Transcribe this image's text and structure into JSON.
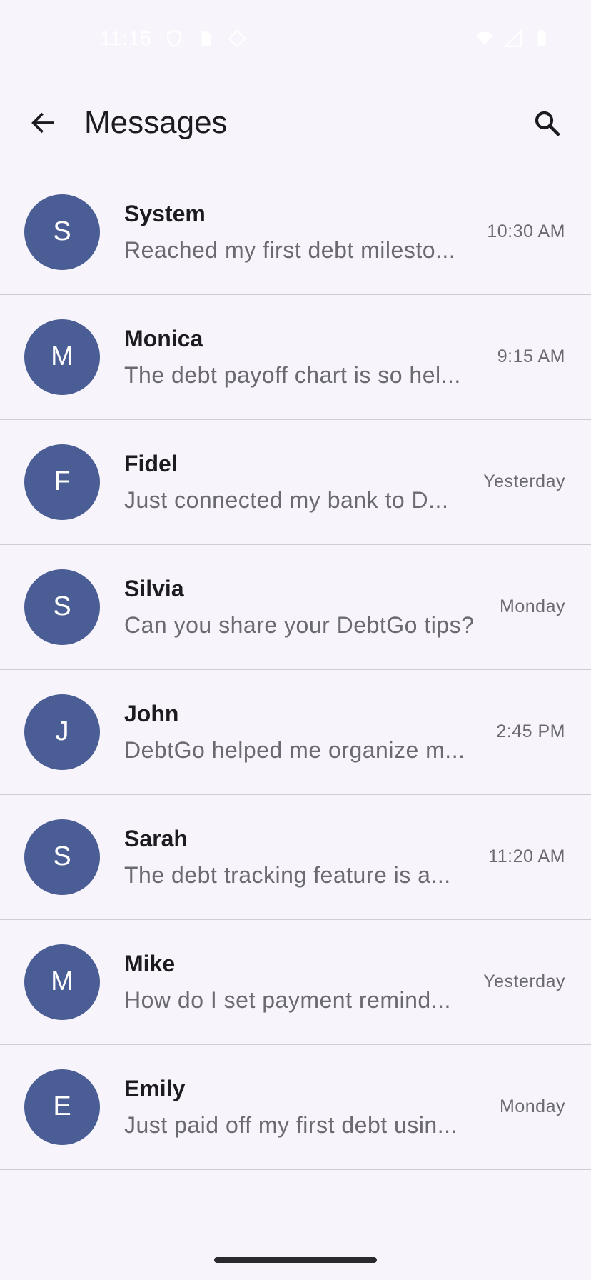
{
  "status_bar": {
    "time": "11:15",
    "icons": [
      "shield-icon",
      "sim-card-icon",
      "location-icon",
      "wifi-icon",
      "cell-signal-icon",
      "battery-icon"
    ]
  },
  "app_bar": {
    "title": "Messages",
    "back_icon": "arrow-back-icon",
    "search_icon": "search-icon"
  },
  "messages": [
    {
      "initial": "S",
      "name": "System",
      "preview": "Reached my first debt milesto...",
      "time": "10:30 AM"
    },
    {
      "initial": "M",
      "name": "Monica",
      "preview": "The debt payoff chart is so hel...",
      "time": "9:15 AM"
    },
    {
      "initial": "F",
      "name": "Fidel",
      "preview": "Just connected my bank to D...",
      "time": "Yesterday"
    },
    {
      "initial": "S",
      "name": "Silvia",
      "preview": "Can you share your DebtGo tips?",
      "time": "Monday"
    },
    {
      "initial": "J",
      "name": "John",
      "preview": "DebtGo helped me organize m...",
      "time": "2:45 PM"
    },
    {
      "initial": "S",
      "name": "Sarah",
      "preview": "The debt tracking feature is a...",
      "time": "11:20 AM"
    },
    {
      "initial": "M",
      "name": "Mike",
      "preview": "How do I set payment remind...",
      "time": "Yesterday"
    },
    {
      "initial": "E",
      "name": "Emily",
      "preview": "Just paid off my first debt usin...",
      "time": "Monday"
    }
  ],
  "colors": {
    "background": "#f7f5fb",
    "avatar": "#4a5d94",
    "divider": "#cfcdd3",
    "secondary_text": "#6b6a70"
  }
}
